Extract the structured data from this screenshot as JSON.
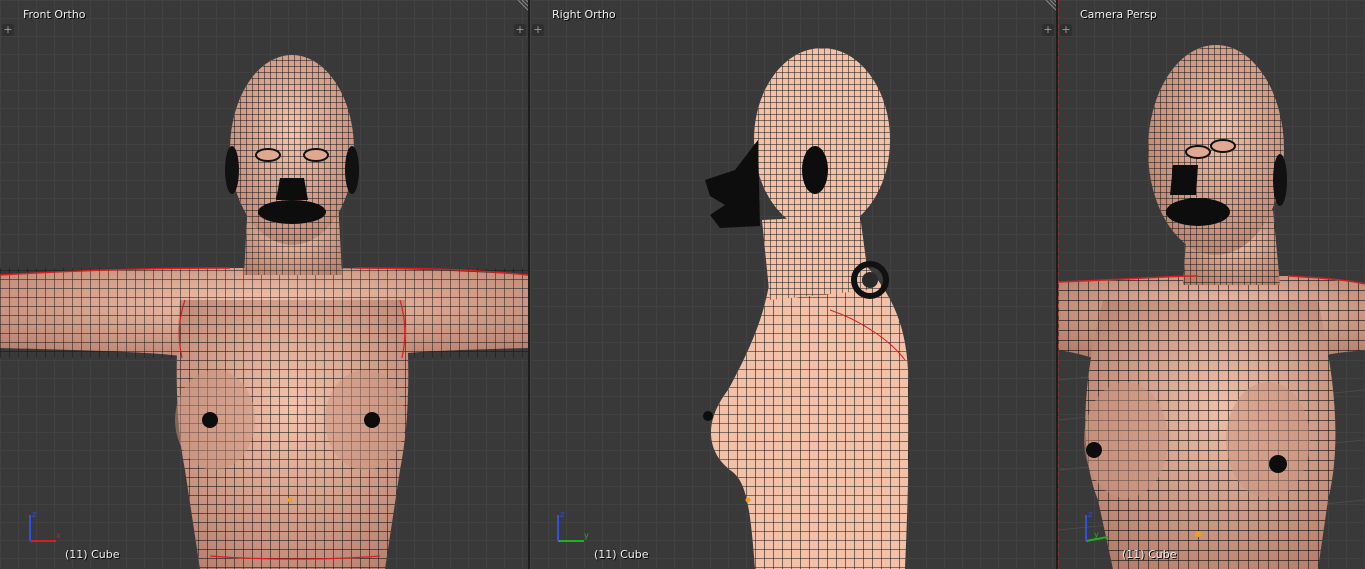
{
  "viewports": [
    {
      "view_label": "Front Ortho",
      "object_label": "(11) Cube",
      "axes": {
        "horizontal": "x",
        "vertical": "z"
      }
    },
    {
      "view_label": "Right Ortho",
      "object_label": "(11) Cube",
      "axes": {
        "horizontal": "y",
        "vertical": "z"
      }
    },
    {
      "view_label": "Camera Persp",
      "object_label": "(11) Cube",
      "axes": {
        "horizontal": "y",
        "vertical": "z"
      }
    }
  ],
  "buttons": {
    "toolshelf_toggle": "+",
    "properties_toggle": "+"
  },
  "colors": {
    "viewport_bg": "#393939",
    "grid_line": "#414141",
    "mesh_skin": "#e8b39c",
    "wire": "#111111",
    "seam": "#d42020",
    "axis_x": "#d02020",
    "axis_y": "#20b020",
    "axis_z": "#3050e0"
  },
  "icons": {
    "toolshelf": "plus-icon",
    "properties": "plus-icon",
    "split_area": "corner-grip-icon",
    "axes": "axis-gizmo-icon"
  }
}
